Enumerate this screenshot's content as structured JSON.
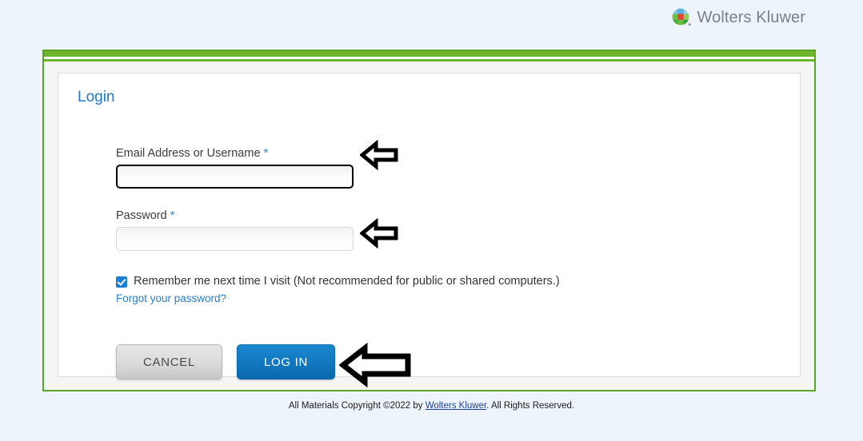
{
  "brand": {
    "name": "Wolters Kluwer",
    "logo_icon": "wolters-kluwer-globe-icon"
  },
  "panel": {
    "title": "Login"
  },
  "form": {
    "email": {
      "label": "Email Address or Username",
      "required_marker": "*",
      "value": "",
      "placeholder": "",
      "focused": true
    },
    "password": {
      "label": "Password",
      "required_marker": "*",
      "value": "",
      "placeholder": "",
      "focused": false
    },
    "remember": {
      "checked": true,
      "label": "Remember me next time I visit (Not recommended for public or shared computers.)"
    },
    "forgot_link": "Forgot your password?"
  },
  "buttons": {
    "cancel_label": "CANCEL",
    "login_label": "LOG IN"
  },
  "annotations": {
    "arrow_email": "left-arrow-icon",
    "arrow_password": "left-arrow-icon",
    "arrow_login": "left-arrow-icon"
  },
  "footer": {
    "prefix": "All Materials Copyright ©2022 by ",
    "link": "Wolters Kluwer",
    "suffix": ". All Rights Reserved."
  },
  "colors": {
    "page_background": "#eef4fc",
    "panel_border_green": "#5aa524",
    "panel_bar_green": "#6cb52d",
    "title_blue": "#1f7ac4",
    "login_button_blue": "#1178bf",
    "checkbox_blue": "#1a7fd4",
    "link_blue": "#2b7ec4",
    "brand_gray": "#7b8084"
  }
}
